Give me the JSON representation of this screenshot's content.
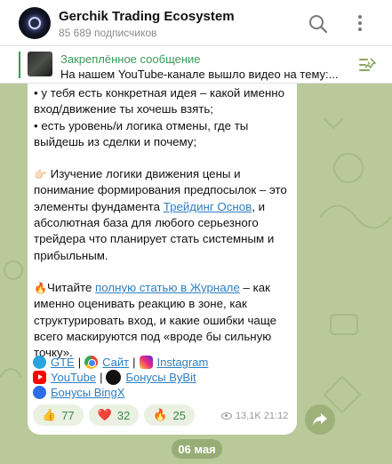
{
  "header": {
    "channel_name": "Gerchik Trading Ecosystem",
    "subscribers": "85 689 подписчиков",
    "icons": [
      "search-icon",
      "more-vertical-icon"
    ]
  },
  "pinned": {
    "label": "Закреплённое сообщение",
    "text": "На нашем YouTube-канале вышло видео на тему:..."
  },
  "message": {
    "line1": "• у тебя есть конкретная идея – какой именно вход/движение ты хочешь взять;",
    "line2": "• есть уровень/и логика отмены, где ты выйдешь из сделки и почему;",
    "p2_emoji": "👉🏻",
    "p2_text_before": " Изучение логики движения цены и понимание формирования предпосылок – это элементы фундамента ",
    "p2_link": "Трейдинг Основ",
    "p2_text_after": ", и абсолютная база для любого серьезного трейдера что планирует стать системным и прибыльным.",
    "p3_emoji": "🔥",
    "p3_text_before": "Читайте ",
    "p3_link": "полную статью в Журнале",
    "p3_text_after": " – как именно оценивать реакцию в зоне, как структурировать вход, и какие ошибки чаще всего маскируются под «вроде бы сильную точку»."
  },
  "links": {
    "gte": "GTE",
    "site": "Сайт",
    "instagram": "Instagram",
    "youtube": "YouTube",
    "bybit": "Бонусы ByBit",
    "bingx": "Бонусы BingX",
    "separator": "|"
  },
  "reactions": [
    {
      "emoji": "👍",
      "count": "77"
    },
    {
      "emoji": "❤️",
      "count": "32"
    },
    {
      "emoji": "🔥",
      "count": "25"
    }
  ],
  "meta": {
    "views": "13,1K",
    "time": "21:12"
  },
  "date_separator": "06 мая",
  "colors": {
    "accent": "#3a9a56",
    "link": "#2d7fc3",
    "background": "#b9c99a"
  }
}
